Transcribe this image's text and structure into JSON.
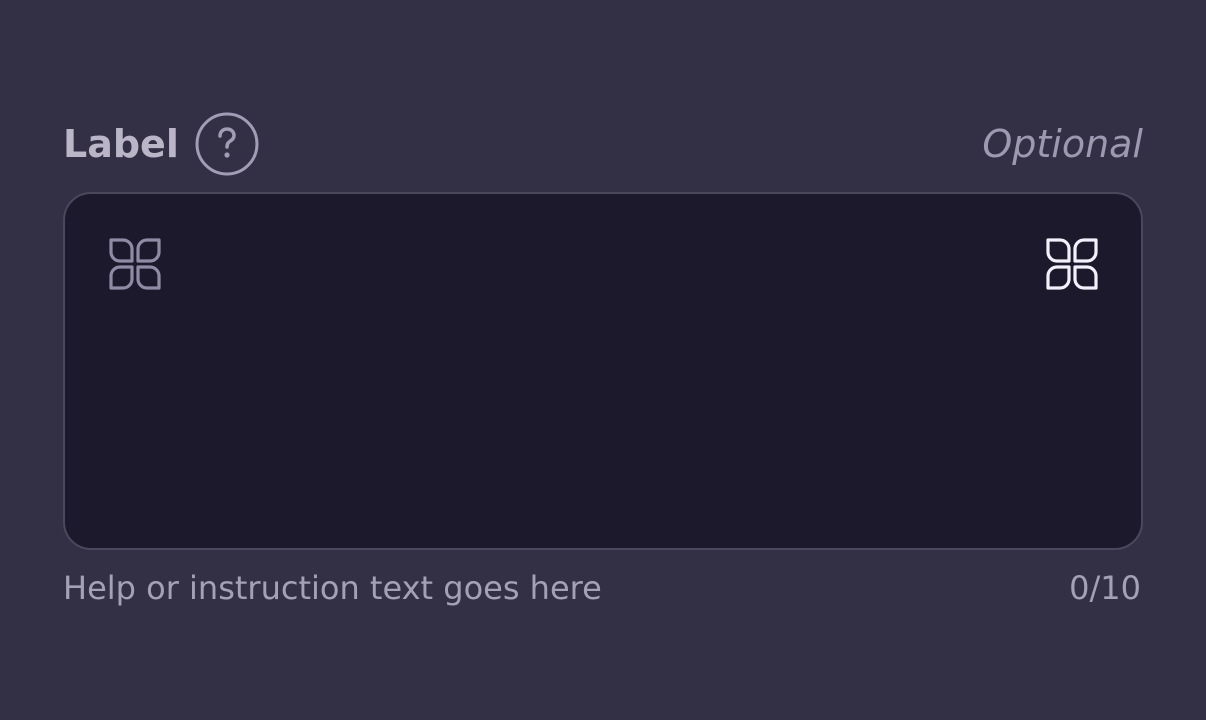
{
  "field": {
    "label": "Label",
    "optional": "Optional",
    "value": "",
    "help_text": "Help or instruction text goes here",
    "counter": "0/10"
  },
  "icons": {
    "help": "question-circle-icon",
    "leading": "four-petal-grid-icon",
    "trailing": "four-petal-grid-icon"
  },
  "colors": {
    "background": "#332f45",
    "input_background": "#1b192b",
    "input_border": "#4b475d",
    "label": "#bab6c8",
    "muted": "#a4a0b6",
    "trailing_icon": "#f2f0fb"
  }
}
